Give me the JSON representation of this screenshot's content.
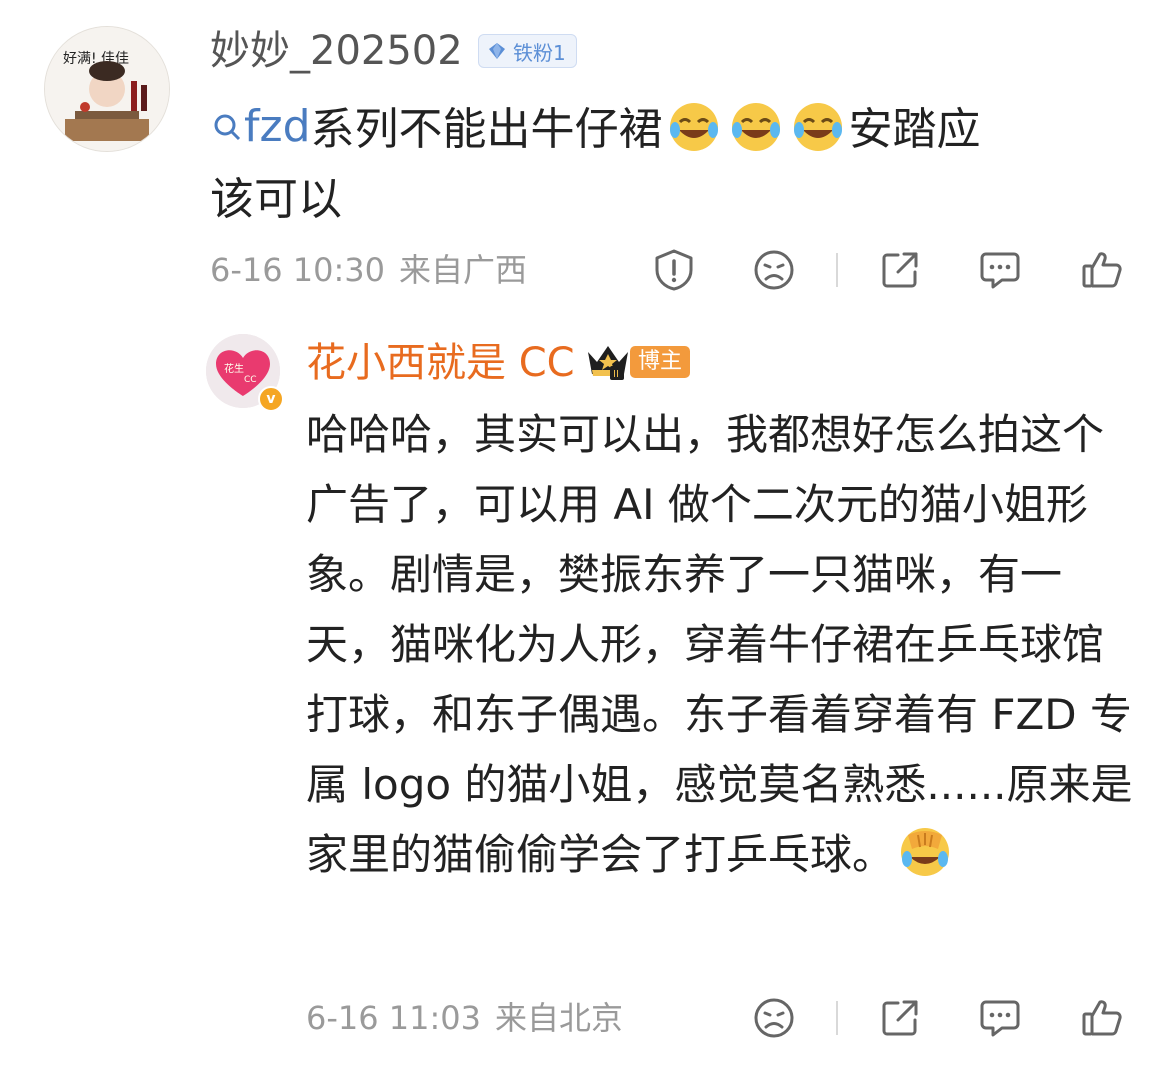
{
  "comment1": {
    "username": "妙妙_202502",
    "fan_badge": "铁粉1",
    "topic_link": "fzd",
    "text_after_topic": "系列不能出牛仔裙",
    "text_end_line1": "安踏应",
    "text_line2": "该可以",
    "emoji": "laugh-cry-emoji",
    "date": "6-16 10:30",
    "location": "来自广西"
  },
  "comment2": {
    "username": "花小西就是 CC",
    "blogger_badge": "博主",
    "text_main": "哈哈哈，其实可以出，我都想好怎么拍这个广告了，可以用 AI 做个二次元的猫小姐形象。剧情是，樊振东养了一只猫咪，有一天，猫咪化为人形，穿着牛仔裙在乒乓球馆打球，和东子偶遇。东子看着穿着有 FZD 专属 logo 的猫小姐，感觉莫名熟悉......原来是家里的猫偷偷学会了打乒乓球。",
    "date": "6-16 11:03",
    "location": "来自北京"
  },
  "colors": {
    "topic_blue": "#4a7cc0",
    "username_orange": "#e86b1f",
    "badge_orange": "#f39a3c",
    "meta_gray": "#9a9a9a"
  },
  "icons": [
    "report-icon",
    "dislike-face-icon",
    "share-icon",
    "comment-icon",
    "like-icon"
  ]
}
